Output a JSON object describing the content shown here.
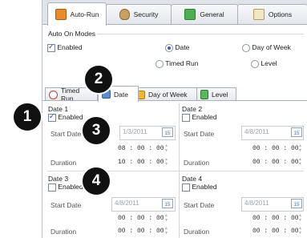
{
  "top_tabs": [
    {
      "label": "Auto-Run",
      "icon": "auto-run-icon"
    },
    {
      "label": "Security",
      "icon": "security-icon"
    },
    {
      "label": "General",
      "icon": "general-icon"
    },
    {
      "label": "Options",
      "icon": "options-icon"
    }
  ],
  "auto_on": {
    "section_label": "Auto On Modes",
    "enabled_label": "Enabled",
    "modes": [
      "Date",
      "Day of Week",
      "Timed Run",
      "Level"
    ],
    "selected_mode": "Date"
  },
  "mode_tabs": [
    "Timed Run",
    "Date",
    "Day of Week",
    "Level"
  ],
  "date_slots": [
    {
      "title": "Date 1",
      "enabled_label": "Enabled",
      "enabled": true,
      "start_label": "Start Date",
      "start_value": "1/3/2011",
      "time_value": "08 : 00 : 00",
      "duration_label": "Duration",
      "duration_value": "10 : 00 : 00"
    },
    {
      "title": "Date 2",
      "enabled_label": "Enabled",
      "enabled": false,
      "start_label": "Start Date",
      "start_value": "4/8/2011",
      "time_value": "00 : 00 : 00",
      "duration_label": "Duration",
      "duration_value": "00 : 00 : 00"
    },
    {
      "title": "Date 3",
      "enabled_label": "Enabled",
      "enabled": false,
      "start_label": "Start Date",
      "start_value": "4/8/2011",
      "time_value": "00 : 00 : 00",
      "duration_label": "Duration",
      "duration_value": "00 : 00 : 00"
    },
    {
      "title": "Date 4",
      "enabled_label": "Enabled",
      "enabled": false,
      "start_label": "Start Date",
      "start_value": "4/8/2011",
      "time_value": "00 : 00 : 00",
      "duration_label": "Duration",
      "duration_value": "00 : 00 : 00"
    }
  ],
  "calendar_icon_text": "15",
  "callouts": [
    "1",
    "2",
    "3",
    "4"
  ],
  "colors": {
    "accent": "#2a62c9",
    "tab_border": "#a9b1ba",
    "badge": "#111111"
  }
}
